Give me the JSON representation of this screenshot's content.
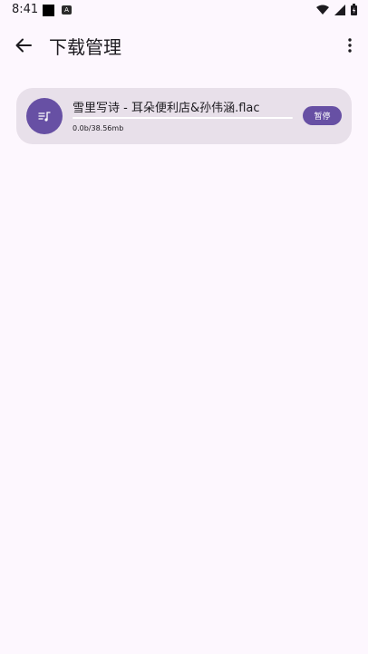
{
  "status_bar": {
    "time": "8:41",
    "notification_icons": [
      "square-icon",
      "a-icon"
    ],
    "right_icons": [
      "wifi-icon",
      "signal-icon",
      "battery-icon"
    ]
  },
  "app_bar": {
    "title": "下载管理",
    "back_icon": "arrow-left-icon",
    "menu_icon": "more-vert-icon"
  },
  "downloads": [
    {
      "file_name": "雪里写诗 - 耳朵便利店&孙伟涵.flac",
      "size": "0.0b/38.56mb",
      "progress_percent": 0,
      "action_label": "暂停",
      "icon": "music-list-icon"
    }
  ],
  "colors": {
    "background": "#fdf7fe",
    "card": "#e8e0ea",
    "accent": "#6750a4"
  }
}
